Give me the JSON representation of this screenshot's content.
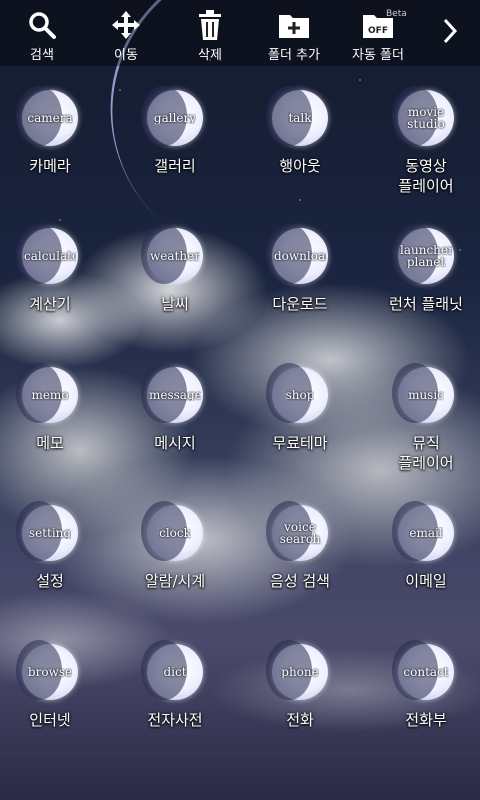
{
  "toolbar": {
    "search": "검색",
    "move": "이동",
    "delete": "삭제",
    "add_folder": "폴더 추가",
    "auto_folder": "자동 폴더",
    "beta": "Beta",
    "off": "OFF"
  },
  "apps": [
    {
      "icon": "camera",
      "label": "카메라"
    },
    {
      "icon": "gallery",
      "label": "갤러리"
    },
    {
      "icon": "talk",
      "label": "행아웃"
    },
    {
      "icon": "movie studio",
      "label": "동영상\n플레이어"
    },
    {
      "icon": "calculator",
      "label": "계산기"
    },
    {
      "icon": "weather",
      "label": "날씨"
    },
    {
      "icon": "download",
      "label": "다운로드"
    },
    {
      "icon": "launcher planet",
      "label": "런처 플래닛"
    },
    {
      "icon": "memo",
      "label": "메모"
    },
    {
      "icon": "message",
      "label": "메시지"
    },
    {
      "icon": "shop",
      "label": "무료테마"
    },
    {
      "icon": "music",
      "label": "뮤직\n플레이어"
    },
    {
      "icon": "setting",
      "label": "설정"
    },
    {
      "icon": "clock",
      "label": "알람/시계"
    },
    {
      "icon": "voice search",
      "label": "음성 검색"
    },
    {
      "icon": "email",
      "label": "이메일"
    },
    {
      "icon": "browse",
      "label": "인터넷"
    },
    {
      "icon": "dict",
      "label": "전자사전"
    },
    {
      "icon": "phone",
      "label": "전화"
    },
    {
      "icon": "contact",
      "label": "전화부"
    }
  ]
}
